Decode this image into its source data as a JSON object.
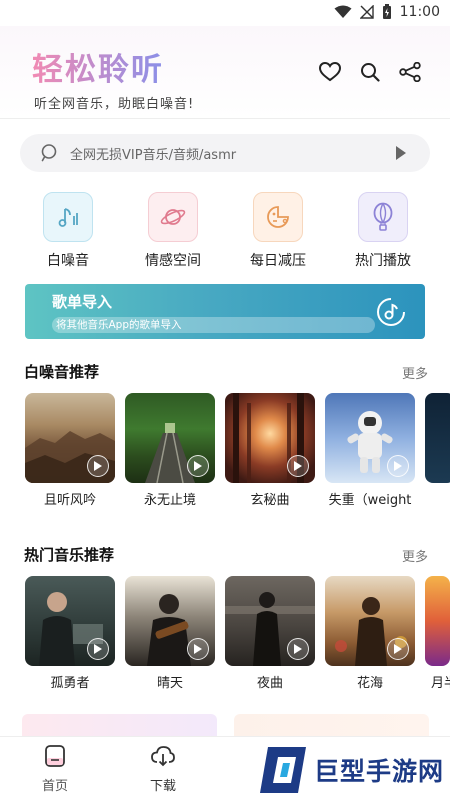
{
  "status_bar": {
    "time": "11:00"
  },
  "header": {
    "title": "轻松聆听",
    "subtitle": "听全网音乐，助眠白噪音!",
    "icons": [
      "heart-icon",
      "search-icon",
      "share-icon"
    ]
  },
  "search": {
    "placeholder": "全网无损VIP音乐/音频/asmr"
  },
  "quick_actions": [
    {
      "label": "白噪音",
      "icon": "music-note-icon",
      "bg": "#e8f6fb",
      "border": "#bfe3f0",
      "fg": "#55a6c4"
    },
    {
      "label": "情感空间",
      "icon": "planet-icon",
      "bg": "#fdeef0",
      "border": "#f5cdd3",
      "fg": "#e07a8e"
    },
    {
      "label": "每日减压",
      "icon": "game-pad-icon",
      "bg": "#fff1e6",
      "border": "#f7d7bd",
      "fg": "#e89a58"
    },
    {
      "label": "热门播放",
      "icon": "balloon-icon",
      "bg": "#f0eefb",
      "border": "#d9d3f2",
      "fg": "#8c82d6"
    }
  ],
  "banner": {
    "title": "歌单导入",
    "subtitle": "将其他音乐App的歌单导入"
  },
  "white_noise": {
    "title": "白噪音推荐",
    "more": "更多",
    "items": [
      {
        "label": "且听风吟",
        "image": "canyon-landscape"
      },
      {
        "label": "永无止境",
        "image": "forest-railway"
      },
      {
        "label": "玄秘曲",
        "image": "mystic-forest"
      },
      {
        "label": "失重（weight",
        "image": "astronaut"
      }
    ]
  },
  "hot_music": {
    "title": "热门音乐推荐",
    "more": "更多",
    "items": [
      {
        "label": "孤勇者",
        "image": "singer-portrait"
      },
      {
        "label": "晴天",
        "image": "album-cover-guitar"
      },
      {
        "label": "夜曲",
        "image": "album-cover-jay-chou"
      },
      {
        "label": "花海",
        "image": "album-cover-garden"
      },
      {
        "label": "月半",
        "image": "album-cover-colorful"
      }
    ]
  },
  "bottom_nav": [
    {
      "label": "首页",
      "icon": "home-icon"
    },
    {
      "label": "下载",
      "icon": "cloud-download-icon"
    }
  ],
  "watermark": {
    "text": "巨型手游网"
  }
}
